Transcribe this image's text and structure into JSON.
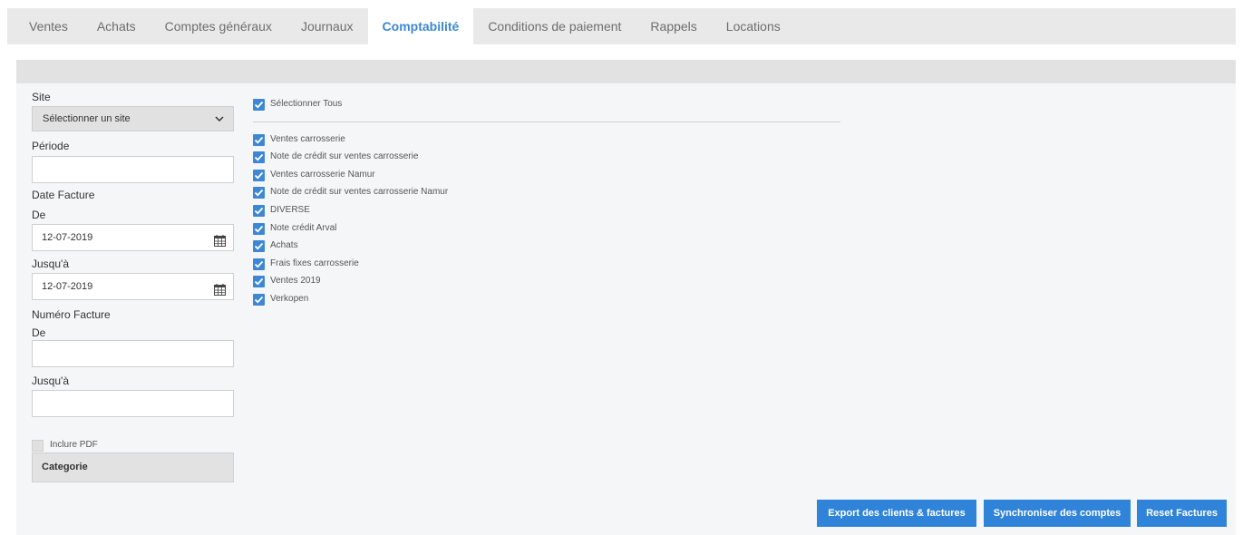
{
  "tabs": [
    {
      "label": "Ventes"
    },
    {
      "label": "Achats"
    },
    {
      "label": "Comptes généraux"
    },
    {
      "label": "Journaux"
    },
    {
      "label": "Comptabilité"
    },
    {
      "label": "Conditions de paiement"
    },
    {
      "label": "Rappels"
    },
    {
      "label": "Locations"
    }
  ],
  "active_tab": "Comptabilité",
  "form": {
    "site_label": "Site",
    "site_select_value": "Sélectionner un site",
    "periode_label": "Période",
    "periode_value": "",
    "date_facture_label": "Date Facture",
    "date_de_label": "De",
    "date_de_value": "12-07-2019",
    "date_jusqua_label": "Jusqu'à",
    "date_jusqua_value": "12-07-2019",
    "numero_facture_label": "Numéro Facture",
    "numero_de_label": "De",
    "numero_de_value": "",
    "numero_jusqua_label": "Jusqu'à",
    "numero_jusqua_value": "",
    "inclure_pdf_label": "Inclure PDF",
    "inclure_pdf_checked": false,
    "categorie_label": "Categorie"
  },
  "journals": {
    "select_all_label": "Sélectionner Tous",
    "select_all_checked": true,
    "items": [
      {
        "label": "Ventes carrosserie",
        "checked": true
      },
      {
        "label": "Note de crédit sur ventes carrosserie",
        "checked": true
      },
      {
        "label": "Ventes carrosserie Namur",
        "checked": true
      },
      {
        "label": "Note de crédit sur ventes carrosserie Namur",
        "checked": true
      },
      {
        "label": "DIVERSE",
        "checked": true
      },
      {
        "label": "Note crédit Arval",
        "checked": true
      },
      {
        "label": "Achats",
        "checked": true
      },
      {
        "label": "Frais fixes carrosserie",
        "checked": true
      },
      {
        "label": "Ventes 2019",
        "checked": true
      },
      {
        "label": "Verkopen",
        "checked": true
      }
    ]
  },
  "buttons": {
    "export": "Export des clients & factures",
    "sync": "Synchroniser des comptes",
    "reset": "Reset Factures"
  },
  "colors": {
    "accent": "#3d87d4",
    "button": "#2f83d8",
    "tabbar": "#e9e9e9",
    "panel": "#f5f6f8"
  },
  "icons": {
    "calendar": "calendar-icon",
    "chevron": "chevron-down-icon",
    "check": "check-icon"
  }
}
